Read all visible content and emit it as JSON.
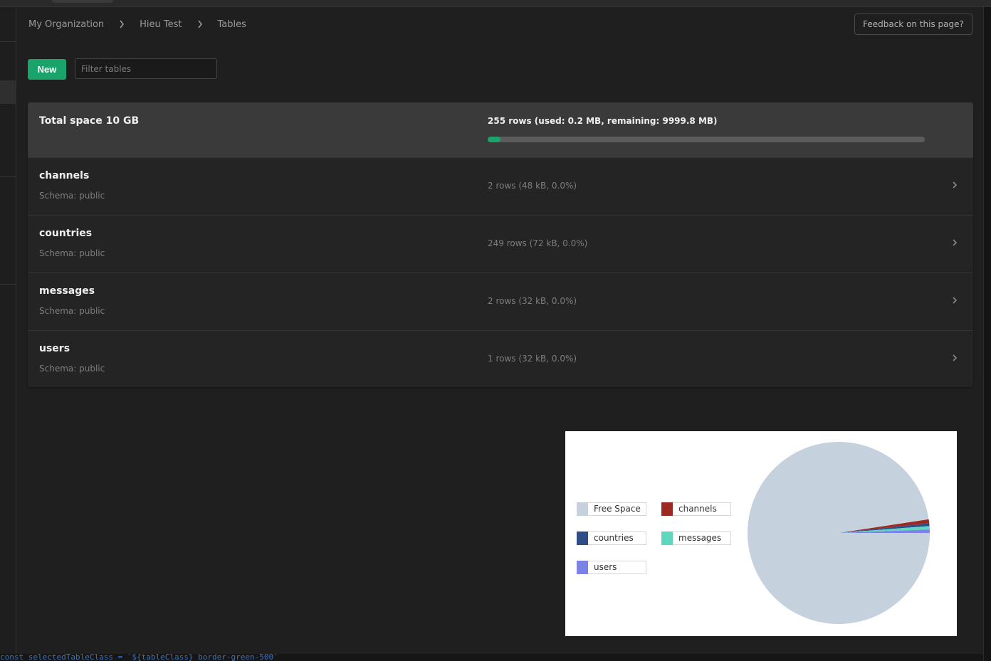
{
  "breadcrumb": [
    "My Organization",
    "Hieu Test",
    "Tables"
  ],
  "feedback_label": "Feedback on this page?",
  "toolbar": {
    "new_label": "New",
    "filter_placeholder": "Filter tables"
  },
  "summary": {
    "total_label": "Total space 10 GB",
    "usage_text": "255 rows (used: 0.2 MB, remaining: 9999.8 MB)",
    "progress_percent": 3
  },
  "tables": [
    {
      "name": "channels",
      "schema": "Schema: public",
      "stats": "2 rows (48 kB, 0.0%)"
    },
    {
      "name": "countries",
      "schema": "Schema: public",
      "stats": "249 rows (72 kB, 0.0%)"
    },
    {
      "name": "messages",
      "schema": "Schema: public",
      "stats": "2 rows (32 kB, 0.0%)"
    },
    {
      "name": "users",
      "schema": "Schema: public",
      "stats": "1 rows (32 kB, 0.0%)"
    }
  ],
  "bottom_code": "const selectedTableClass = `${tableClass} border-green-500`",
  "colors": {
    "accent": "#1aa36b",
    "free_space": "#c5d1dd",
    "channels": "#9c2a22",
    "countries": "#2d4f85",
    "messages": "#5fd6bf",
    "users": "#7b84e6"
  },
  "chart_data": {
    "type": "pie",
    "labels": [
      "Free Space",
      "channels",
      "countries",
      "messages",
      "users"
    ],
    "values": [
      97.6,
      0.7,
      0.5,
      0.6,
      0.6
    ],
    "colors": [
      "#c5d1dd",
      "#9c2a22",
      "#2d4f85",
      "#5fd6bf",
      "#7b84e6"
    ],
    "legend_position": "left"
  }
}
